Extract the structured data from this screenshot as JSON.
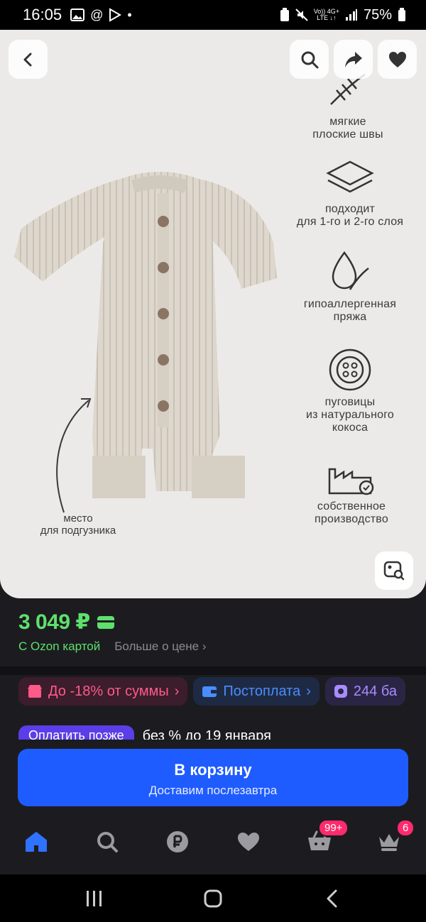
{
  "status_bar": {
    "time": "16:05",
    "battery": "75%",
    "net_top": "Vo)) 4G+",
    "net_bottom": "LTE ↓↑"
  },
  "product_image": {
    "features": [
      {
        "label": "мягкие\nплоские швы",
        "icon": "stitch-icon"
      },
      {
        "label": "подходит\nдля 1-го и 2-го слоя",
        "icon": "layers-icon"
      },
      {
        "label": "гипоаллергенная\nпряжа",
        "icon": "drop-leaf-icon"
      },
      {
        "label": "пуговицы\nиз натурального\nкокоса",
        "icon": "button-icon"
      },
      {
        "label": "собственное\nпроизводство",
        "icon": "factory-icon"
      }
    ],
    "diaper_note": "место\nдля подгузника"
  },
  "price": {
    "value": "3 049 ₽",
    "ozon_card": "С Ozon картой",
    "more": "Больше о цене"
  },
  "chips": [
    {
      "label": "До -18% от суммы"
    },
    {
      "label": "Постоплата"
    },
    {
      "label": "244 ба"
    }
  ],
  "pay_later": {
    "badge": "Оплатить позже",
    "text": "без % до 19 января"
  },
  "cart_button": {
    "title": "В корзину",
    "subtitle": "Доставим послезавтра"
  },
  "bottom_nav": {
    "cart_badge": "99+",
    "profile_badge": "6"
  },
  "colors": {
    "accent": "#1f5cff",
    "price_green": "#5ee06d",
    "discount_pink": "#ff5a8a",
    "badge_pink": "#ff2a6d"
  }
}
